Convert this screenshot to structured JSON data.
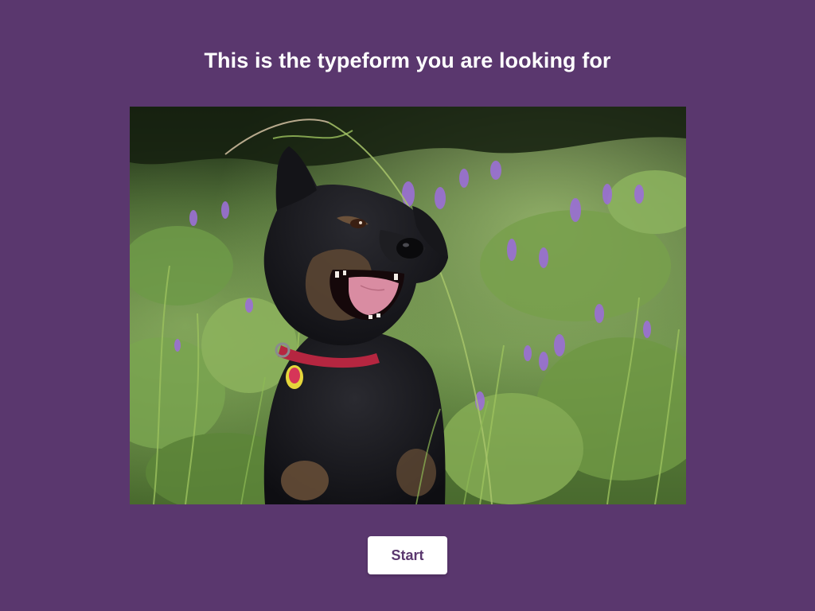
{
  "welcome": {
    "title": "This is the typeform you are looking for",
    "start_label": "Start"
  },
  "image": {
    "subject": "dog-photo"
  },
  "colors": {
    "background": "#5a376e",
    "button_background": "#ffffff",
    "button_text": "#5a376e",
    "title_text": "#ffffff"
  }
}
